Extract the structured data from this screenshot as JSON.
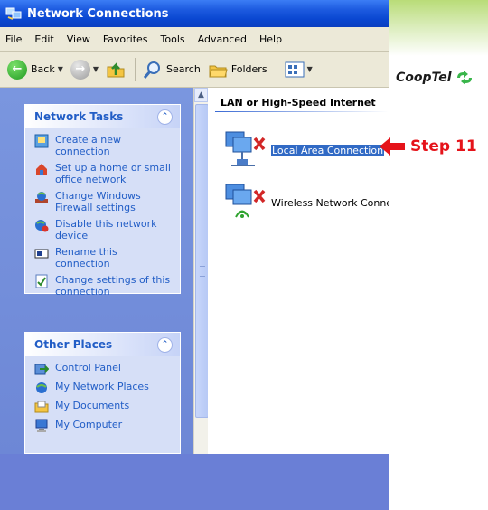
{
  "window": {
    "title": "Network Connections"
  },
  "menu": [
    "File",
    "Edit",
    "View",
    "Favorites",
    "Tools",
    "Advanced",
    "Help"
  ],
  "toolbar": {
    "back": "Back",
    "search": "Search",
    "folders": "Folders"
  },
  "network_tasks": {
    "header": "Network Tasks",
    "items": [
      {
        "label": "Create a new connection",
        "icon": "new-connection-icon"
      },
      {
        "label": "Set up a home or small office network",
        "icon": "home-network-icon"
      },
      {
        "label": "Change Windows Firewall settings",
        "icon": "firewall-icon"
      },
      {
        "label": "Disable this network device",
        "icon": "disable-device-icon"
      },
      {
        "label": "Rename this connection",
        "icon": "rename-icon"
      },
      {
        "label": "Change settings of this connection",
        "icon": "settings-icon"
      }
    ]
  },
  "other_places": {
    "header": "Other Places",
    "items": [
      {
        "label": "Control Panel",
        "icon": "control-panel-icon"
      },
      {
        "label": "My Network Places",
        "icon": "network-places-icon"
      },
      {
        "label": "My Documents",
        "icon": "documents-icon"
      },
      {
        "label": "My Computer",
        "icon": "computer-icon"
      }
    ]
  },
  "content": {
    "group_header": "LAN or High-Speed Internet",
    "connections": [
      {
        "label": "Local Area Connection",
        "selected": true,
        "status": "disconnected"
      },
      {
        "label": "Wireless Network Connec",
        "selected": false,
        "status": "disconnected"
      }
    ]
  },
  "annotation": {
    "label": "Step 11",
    "color": "#e5131a"
  },
  "brand": {
    "name": "CoopTel"
  }
}
